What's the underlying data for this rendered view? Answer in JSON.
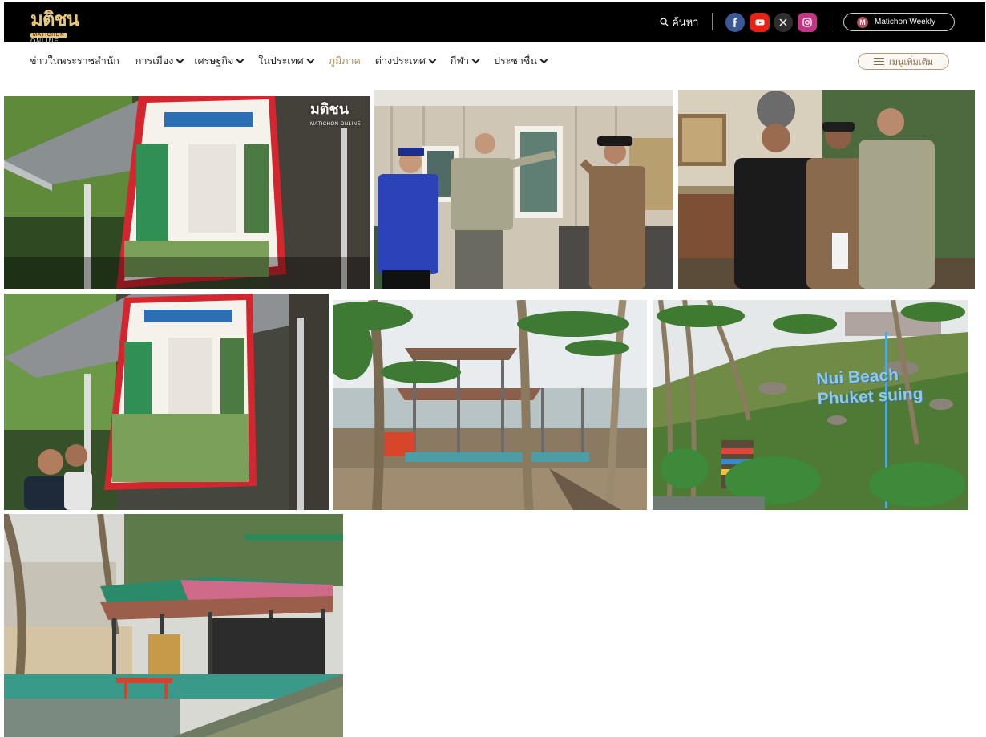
{
  "header": {
    "logo_text": "มติชน",
    "logo_sub": "ONLINE",
    "logo_badge": "MATICHON",
    "search_label": "ค้นหา",
    "social_icons": [
      "facebook-icon",
      "youtube-icon",
      "x-icon",
      "instagram-icon"
    ],
    "weekly_badge": "M",
    "weekly_label": "Matichon Weekly"
  },
  "nav": {
    "items": [
      {
        "label": "ข่าวในพระราชสำนัก",
        "dropdown": false,
        "active": false
      },
      {
        "label": "การเมือง",
        "dropdown": true,
        "active": false
      },
      {
        "label": "เศรษฐกิจ",
        "dropdown": true,
        "active": false
      },
      {
        "label": "ในประเทศ",
        "dropdown": true,
        "active": false
      },
      {
        "label": "ภูมิภาค",
        "dropdown": false,
        "active": true
      },
      {
        "label": "ต่างประเทศ",
        "dropdown": true,
        "active": false
      },
      {
        "label": "กีฬา",
        "dropdown": true,
        "active": false
      },
      {
        "label": "ประชาชื่น",
        "dropdown": true,
        "active": false
      }
    ],
    "more_label": "เมนูเพิ่มเติม"
  },
  "gallery": {
    "watermark": "มติชน",
    "watermark_sub": "MATICHON ONLINE",
    "sign_text_line1": "Nui Beach",
    "sign_text_line2": "Phuket suing"
  },
  "colors": {
    "topbar_bg": "#000000",
    "accent_gold": "#a58b5e",
    "facebook": "#3b5998",
    "youtube": "#e62117",
    "x": "#333333",
    "instagram": "#c13584"
  }
}
